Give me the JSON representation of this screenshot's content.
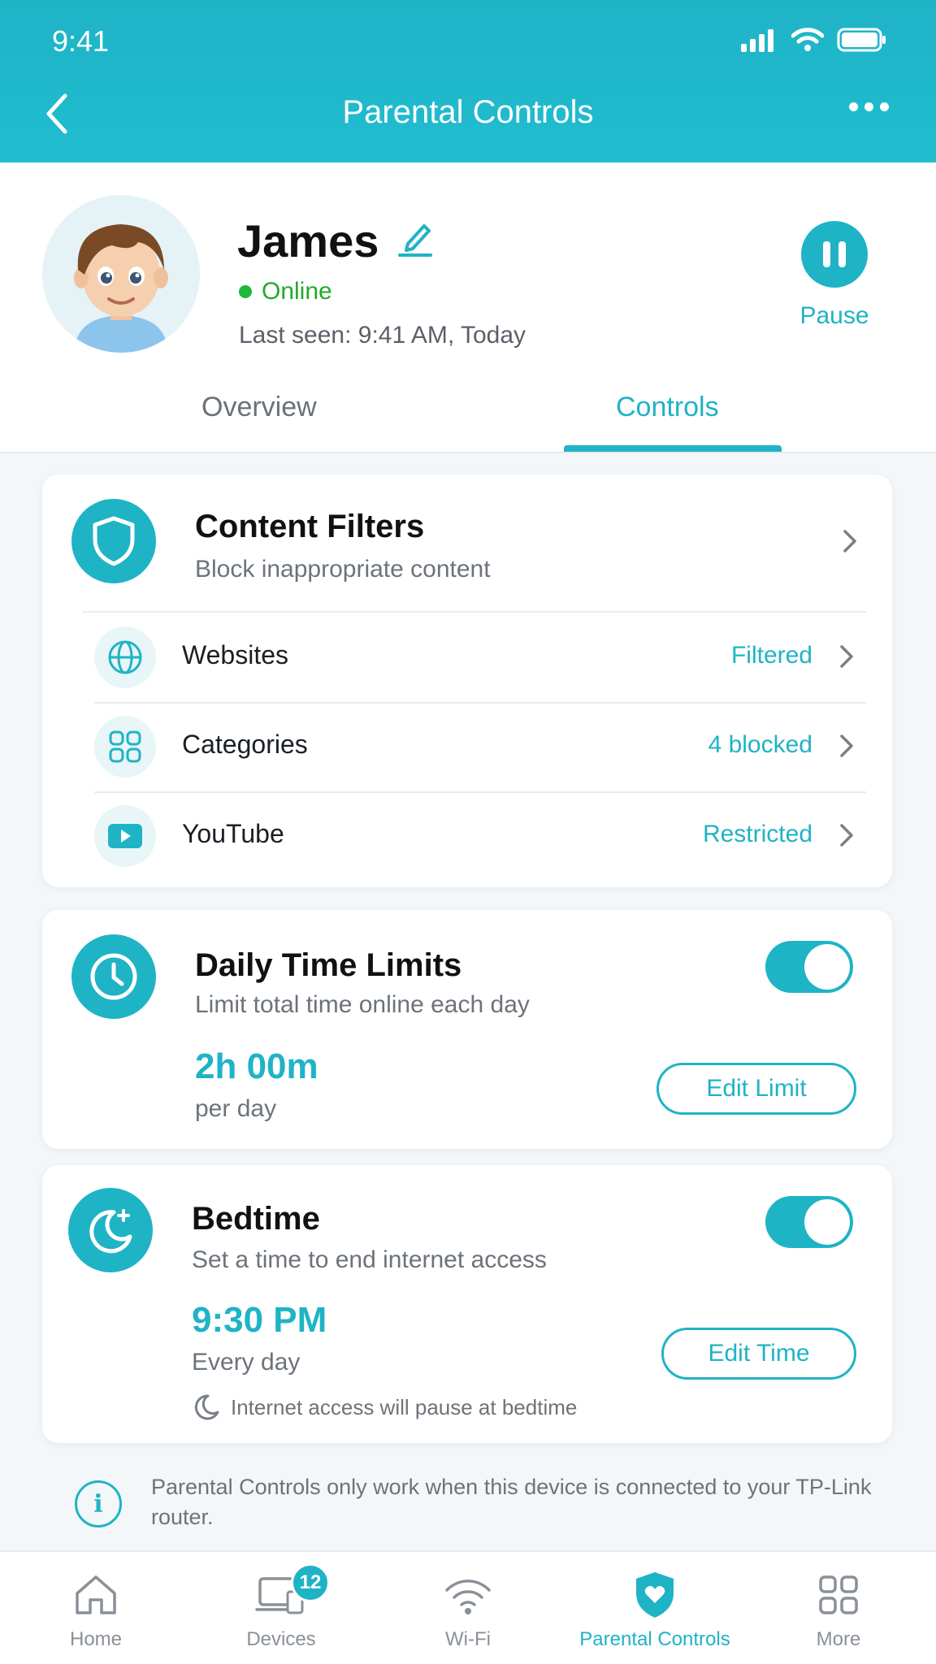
{
  "status_bar": {
    "time": "9:41"
  },
  "header": {
    "title": "Parental Controls"
  },
  "profile": {
    "name": "James",
    "status": "Online",
    "last_seen": "Last seen: 9:41 AM, Today",
    "pause_label": "Pause"
  },
  "tabs": [
    {
      "label": "Overview",
      "active": false
    },
    {
      "label": "Controls",
      "active": true
    }
  ],
  "content_filters": {
    "title": "Content Filters",
    "subtitle": "Block inappropriate content",
    "rows": [
      {
        "label": "Websites",
        "value": "Filtered",
        "icon": "globe-icon"
      },
      {
        "label": "Categories",
        "value": "4 blocked",
        "icon": "grid-icon"
      },
      {
        "label": "YouTube",
        "value": "Restricted",
        "icon": "youtube-icon"
      }
    ]
  },
  "time_limits": {
    "title": "Daily Time Limits",
    "subtitle": "Limit total time online each day",
    "value": "2h 00m",
    "unit": "per day",
    "button": "Edit Limit",
    "enabled": true
  },
  "bedtime": {
    "title": "Bedtime",
    "subtitle": "Set a time to end internet access",
    "value": "9:30 PM",
    "repeat": "Every day",
    "note": "Internet access will pause at bedtime",
    "button": "Edit Time",
    "enabled": true
  },
  "info": {
    "text": "Parental Controls only work when this device is connected to your TP-Link router."
  },
  "bottom_nav": {
    "items": [
      {
        "label": "Home",
        "icon": "home-icon"
      },
      {
        "label": "Devices",
        "icon": "devices-icon",
        "badge": "12"
      },
      {
        "label": "Wi-Fi",
        "icon": "wifi-icon"
      },
      {
        "label": "Parental Controls",
        "icon": "shield-heart-icon",
        "active": true
      },
      {
        "label": "More",
        "icon": "grid-icon"
      }
    ]
  },
  "colors": {
    "accent": "#1fb3c6",
    "online": "#1fb83a"
  }
}
